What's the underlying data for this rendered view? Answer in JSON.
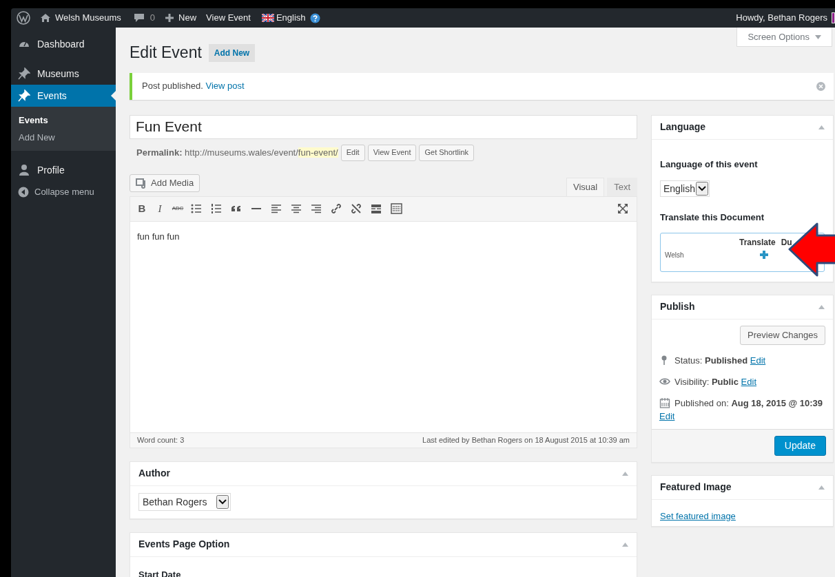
{
  "admin_bar": {
    "site": "Welsh Museums",
    "comments": "0",
    "new": "New",
    "view": "View Event",
    "language": "English",
    "greeting": "Howdy, Bethan Rogers"
  },
  "screen_options": "Screen Options",
  "menu": [
    {
      "label": "Dashboard",
      "selected": false
    },
    {
      "label": "Museums",
      "selected": false
    },
    {
      "label": "Events",
      "selected": true
    }
  ],
  "submenu": [
    {
      "label": "Events",
      "selected": true
    },
    {
      "label": "Add New",
      "selected": false
    }
  ],
  "menu_after": [
    {
      "label": "Profile"
    }
  ],
  "collapse": "Collapse menu",
  "heading": "Edit Event",
  "add_new": "Add New",
  "notice": {
    "text": "Post published.",
    "link": "View post"
  },
  "title_value": "Fun Event",
  "permalink": {
    "text": "**Permalink:** http://museums.wales/event/",
    "slug": "fun-event/",
    "buttons": [
      "Edit",
      "View Event",
      "Get Shortlink"
    ]
  },
  "add_media": "Add Media",
  "editor_tabs": [
    {
      "label": "Visual",
      "selected": true
    },
    {
      "label": "Text",
      "selected": false
    }
  ],
  "toolbar_text": [
    "B",
    "I",
    "ABC"
  ],
  "content": "fun fun fun",
  "word_count": "Word count: 3",
  "last_edited": "Last edited by Bethan Rogers on 18 August 2015 at 10:39 am",
  "author": {
    "title": "Author",
    "value": "Bethan Rogers"
  },
  "events_option": {
    "title": "Events Page Option",
    "field": "Start Date"
  },
  "language_box": {
    "title": "Language",
    "label": "Language of this event",
    "value": "English",
    "translate_label": "Translate this Document",
    "columns": [
      "Translate",
      "Du"
    ],
    "rows": [
      {
        "language": "Welsh"
      }
    ]
  },
  "publish": {
    "title": "Publish",
    "preview": "Preview Changes",
    "rows": [
      {
        "text": "Status: **Published**",
        "link": "Edit"
      },
      {
        "text": "Visibility: **Public**",
        "link": "Edit"
      },
      {
        "text": "Published on: **Aug 18, 2015 @ 10:39**",
        "link": "Edit"
      }
    ],
    "update": "Update"
  },
  "featured": {
    "title": "Featured Image",
    "link": "Set featured image"
  }
}
